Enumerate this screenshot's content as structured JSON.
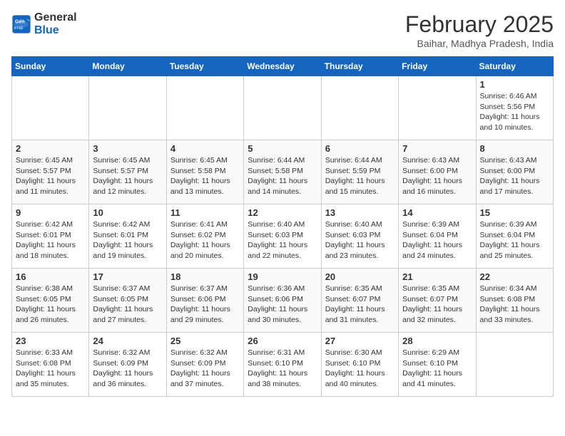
{
  "header": {
    "logo_line1": "General",
    "logo_line2": "Blue",
    "month_title": "February 2025",
    "location": "Baihar, Madhya Pradesh, India"
  },
  "weekdays": [
    "Sunday",
    "Monday",
    "Tuesday",
    "Wednesday",
    "Thursday",
    "Friday",
    "Saturday"
  ],
  "weeks": [
    [
      {
        "day": "",
        "info": ""
      },
      {
        "day": "",
        "info": ""
      },
      {
        "day": "",
        "info": ""
      },
      {
        "day": "",
        "info": ""
      },
      {
        "day": "",
        "info": ""
      },
      {
        "day": "",
        "info": ""
      },
      {
        "day": "1",
        "info": "Sunrise: 6:46 AM\nSunset: 5:56 PM\nDaylight: 11 hours and 10 minutes."
      }
    ],
    [
      {
        "day": "2",
        "info": "Sunrise: 6:45 AM\nSunset: 5:57 PM\nDaylight: 11 hours and 11 minutes."
      },
      {
        "day": "3",
        "info": "Sunrise: 6:45 AM\nSunset: 5:57 PM\nDaylight: 11 hours and 12 minutes."
      },
      {
        "day": "4",
        "info": "Sunrise: 6:45 AM\nSunset: 5:58 PM\nDaylight: 11 hours and 13 minutes."
      },
      {
        "day": "5",
        "info": "Sunrise: 6:44 AM\nSunset: 5:58 PM\nDaylight: 11 hours and 14 minutes."
      },
      {
        "day": "6",
        "info": "Sunrise: 6:44 AM\nSunset: 5:59 PM\nDaylight: 11 hours and 15 minutes."
      },
      {
        "day": "7",
        "info": "Sunrise: 6:43 AM\nSunset: 6:00 PM\nDaylight: 11 hours and 16 minutes."
      },
      {
        "day": "8",
        "info": "Sunrise: 6:43 AM\nSunset: 6:00 PM\nDaylight: 11 hours and 17 minutes."
      }
    ],
    [
      {
        "day": "9",
        "info": "Sunrise: 6:42 AM\nSunset: 6:01 PM\nDaylight: 11 hours and 18 minutes."
      },
      {
        "day": "10",
        "info": "Sunrise: 6:42 AM\nSunset: 6:01 PM\nDaylight: 11 hours and 19 minutes."
      },
      {
        "day": "11",
        "info": "Sunrise: 6:41 AM\nSunset: 6:02 PM\nDaylight: 11 hours and 20 minutes."
      },
      {
        "day": "12",
        "info": "Sunrise: 6:40 AM\nSunset: 6:03 PM\nDaylight: 11 hours and 22 minutes."
      },
      {
        "day": "13",
        "info": "Sunrise: 6:40 AM\nSunset: 6:03 PM\nDaylight: 11 hours and 23 minutes."
      },
      {
        "day": "14",
        "info": "Sunrise: 6:39 AM\nSunset: 6:04 PM\nDaylight: 11 hours and 24 minutes."
      },
      {
        "day": "15",
        "info": "Sunrise: 6:39 AM\nSunset: 6:04 PM\nDaylight: 11 hours and 25 minutes."
      }
    ],
    [
      {
        "day": "16",
        "info": "Sunrise: 6:38 AM\nSunset: 6:05 PM\nDaylight: 11 hours and 26 minutes."
      },
      {
        "day": "17",
        "info": "Sunrise: 6:37 AM\nSunset: 6:05 PM\nDaylight: 11 hours and 27 minutes."
      },
      {
        "day": "18",
        "info": "Sunrise: 6:37 AM\nSunset: 6:06 PM\nDaylight: 11 hours and 29 minutes."
      },
      {
        "day": "19",
        "info": "Sunrise: 6:36 AM\nSunset: 6:06 PM\nDaylight: 11 hours and 30 minutes."
      },
      {
        "day": "20",
        "info": "Sunrise: 6:35 AM\nSunset: 6:07 PM\nDaylight: 11 hours and 31 minutes."
      },
      {
        "day": "21",
        "info": "Sunrise: 6:35 AM\nSunset: 6:07 PM\nDaylight: 11 hours and 32 minutes."
      },
      {
        "day": "22",
        "info": "Sunrise: 6:34 AM\nSunset: 6:08 PM\nDaylight: 11 hours and 33 minutes."
      }
    ],
    [
      {
        "day": "23",
        "info": "Sunrise: 6:33 AM\nSunset: 6:08 PM\nDaylight: 11 hours and 35 minutes."
      },
      {
        "day": "24",
        "info": "Sunrise: 6:32 AM\nSunset: 6:09 PM\nDaylight: 11 hours and 36 minutes."
      },
      {
        "day": "25",
        "info": "Sunrise: 6:32 AM\nSunset: 6:09 PM\nDaylight: 11 hours and 37 minutes."
      },
      {
        "day": "26",
        "info": "Sunrise: 6:31 AM\nSunset: 6:10 PM\nDaylight: 11 hours and 38 minutes."
      },
      {
        "day": "27",
        "info": "Sunrise: 6:30 AM\nSunset: 6:10 PM\nDaylight: 11 hours and 40 minutes."
      },
      {
        "day": "28",
        "info": "Sunrise: 6:29 AM\nSunset: 6:10 PM\nDaylight: 11 hours and 41 minutes."
      },
      {
        "day": "",
        "info": ""
      }
    ]
  ]
}
